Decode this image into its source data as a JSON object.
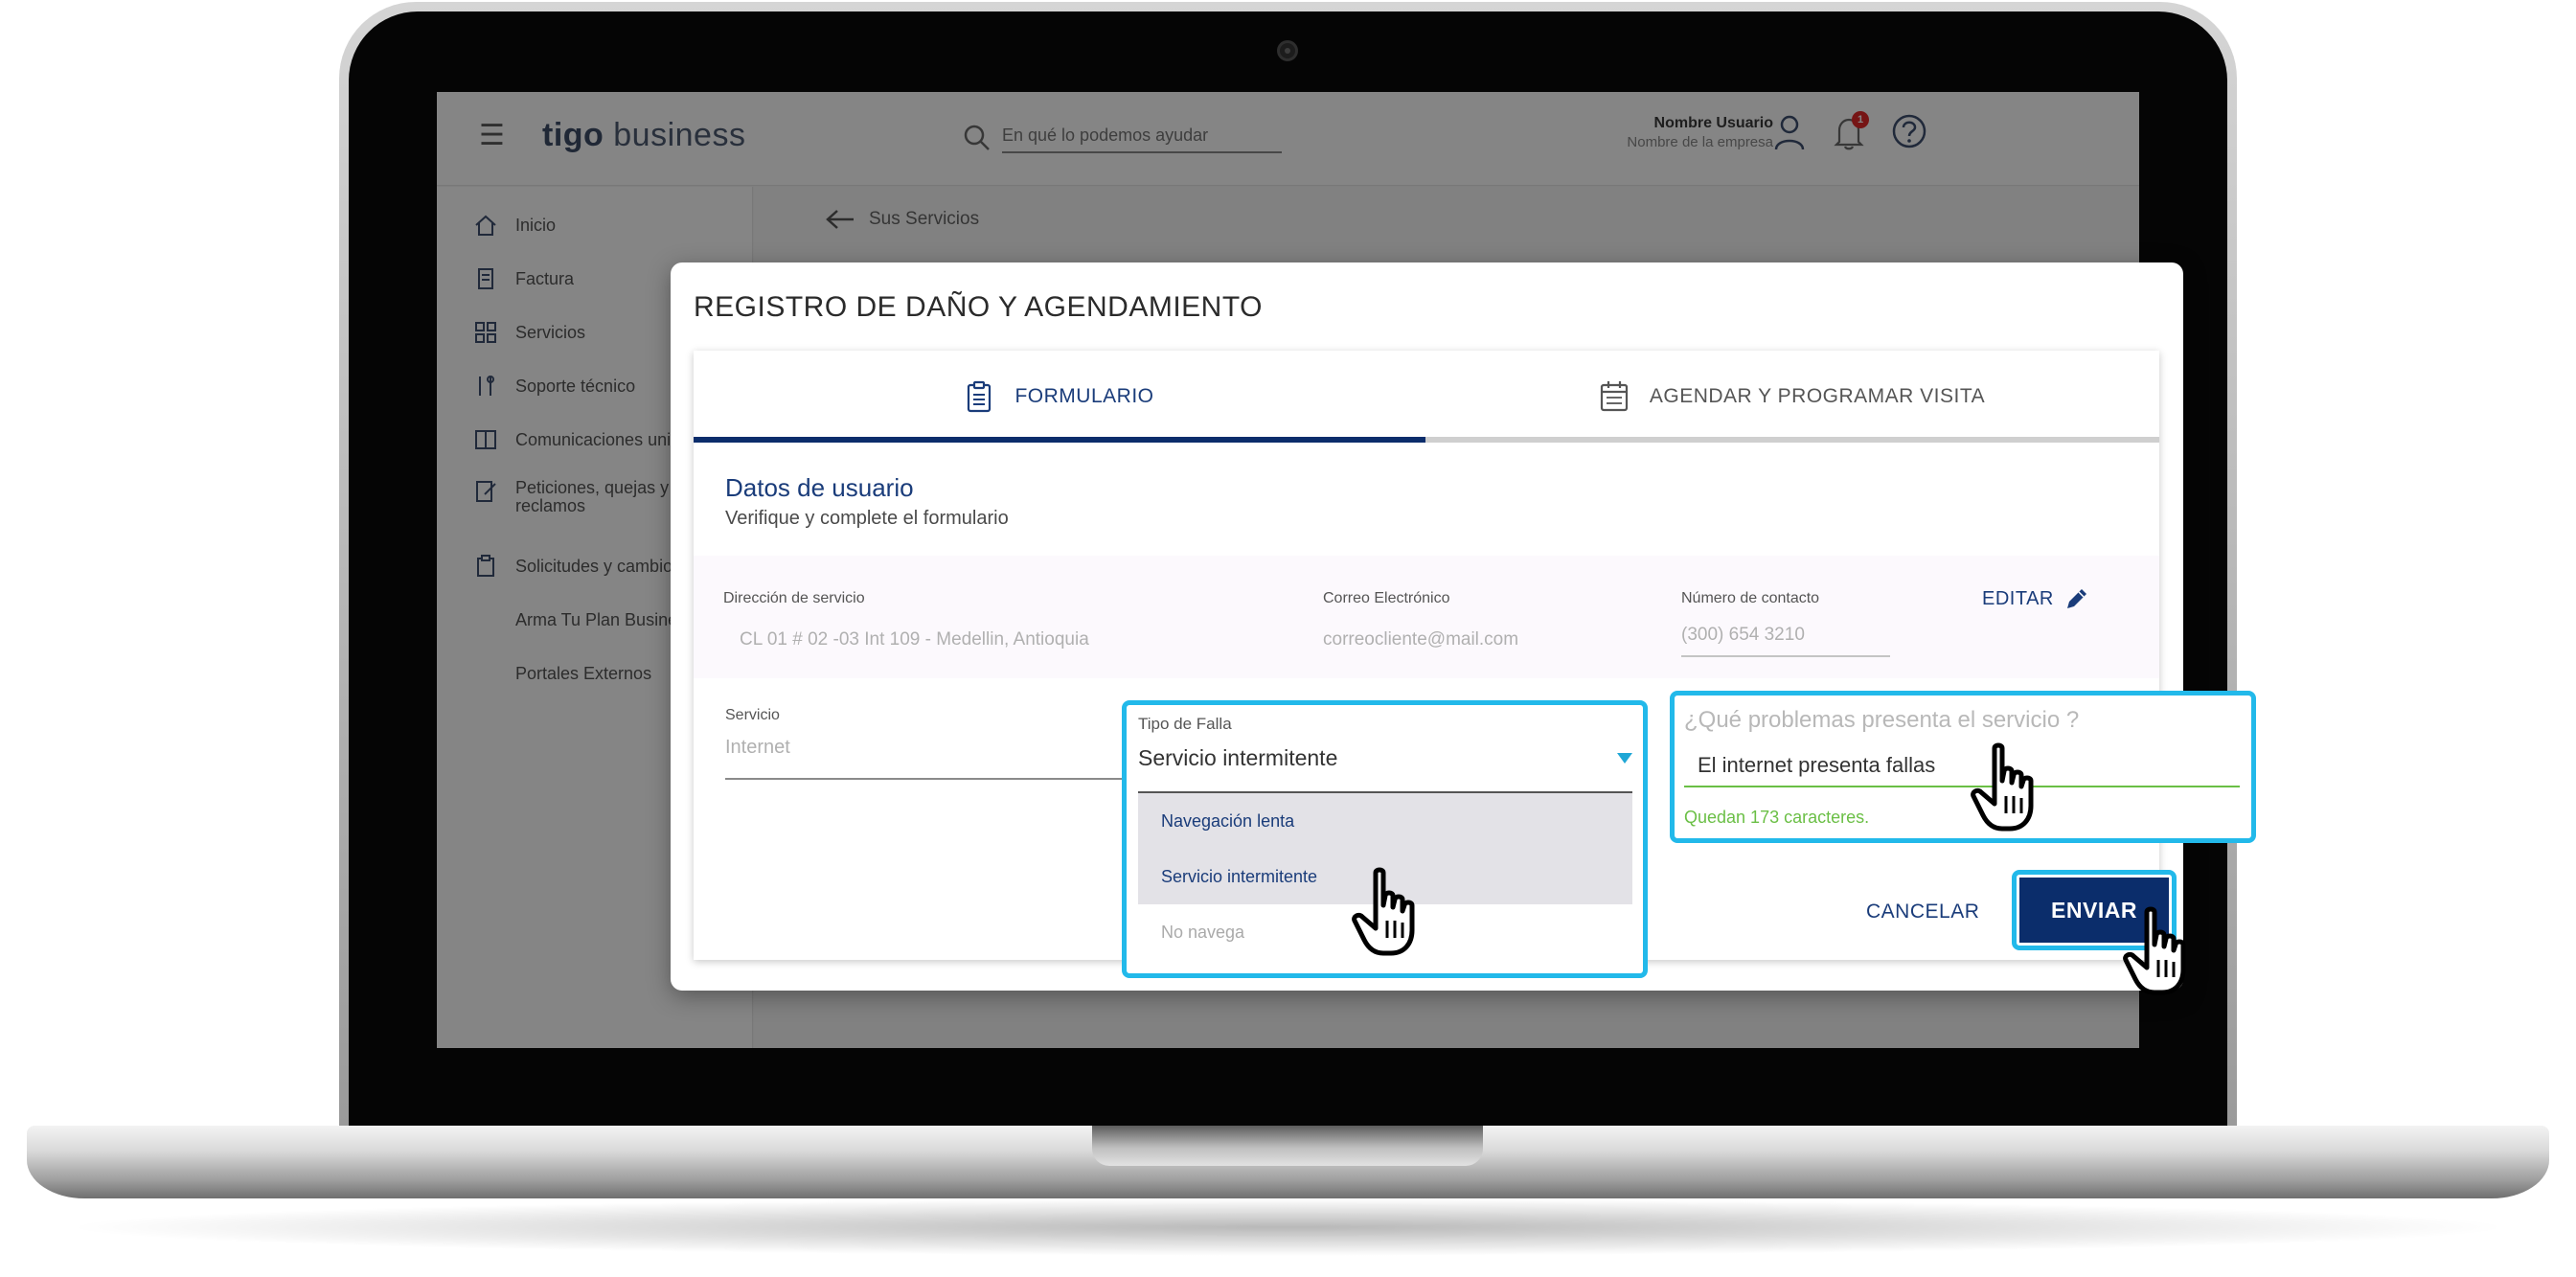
{
  "app": {
    "logo_brand": "tigo",
    "logo_product": "business",
    "menu_icon": "☰"
  },
  "search": {
    "placeholder": "En qué lo podemos ayudar"
  },
  "user": {
    "name": "Nombre Usuario",
    "company": "Nombre de la empresa",
    "notification_count": "1"
  },
  "sidebar": {
    "items": [
      {
        "label": "Inicio",
        "icon": "home-icon"
      },
      {
        "label": "Factura",
        "icon": "invoice-icon"
      },
      {
        "label": "Servicios",
        "icon": "grid-icon"
      },
      {
        "label": "Soporte técnico",
        "icon": "tools-icon"
      },
      {
        "label": "Comunicaciones uni",
        "icon": "book-icon"
      },
      {
        "label": "Peticiones, quejas y reclamos",
        "icon": "edit-doc-icon"
      },
      {
        "label": "Solicitudes y cambio",
        "icon": "clipboard-icon"
      },
      {
        "label": "Arma Tu Plan Busine"
      },
      {
        "label": "Portales Externos"
      }
    ]
  },
  "breadcrumb": {
    "back_label": "Sus Servicios"
  },
  "modal": {
    "title": "REGISTRO DE DAÑO Y AGENDAMIENTO",
    "tabs": [
      {
        "label": "FORMULARIO",
        "icon": "clipboard-icon",
        "active": true
      },
      {
        "label": "AGENDAR Y PROGRAMAR VISITA",
        "icon": "calendar-icon",
        "active": false
      }
    ],
    "section_title": "Datos de usuario",
    "section_subtitle": "Verifique y complete el formulario",
    "fields": {
      "address_label": "Dirección de servicio",
      "address_value": "CL 01 # 02 -03 Int 109 - Medellin, Antioquia",
      "email_label": "Correo Electrónico",
      "email_value": "correocliente@mail.com",
      "phone_label": "Número de contacto",
      "phone_value": "(300) 654 3210"
    },
    "edit_label": "EDITAR",
    "service_label": "Servicio",
    "service_value": "Internet",
    "fault": {
      "label": "Tipo de Falla",
      "selected": "Servicio intermitente",
      "options": [
        "Navegación lenta",
        "Servicio intermitente",
        "No navega"
      ]
    },
    "problem": {
      "label": "¿Qué problemas presenta el servicio ?",
      "value": "El internet presenta fallas",
      "counter": "Quedan 173 caracteres."
    },
    "cancel_label": "CANCELAR",
    "send_label": "ENVIAR"
  },
  "colors": {
    "primary": "#0b2d6b",
    "highlight": "#22b9ea",
    "success": "#6abf45",
    "notification": "#e22a2a"
  }
}
